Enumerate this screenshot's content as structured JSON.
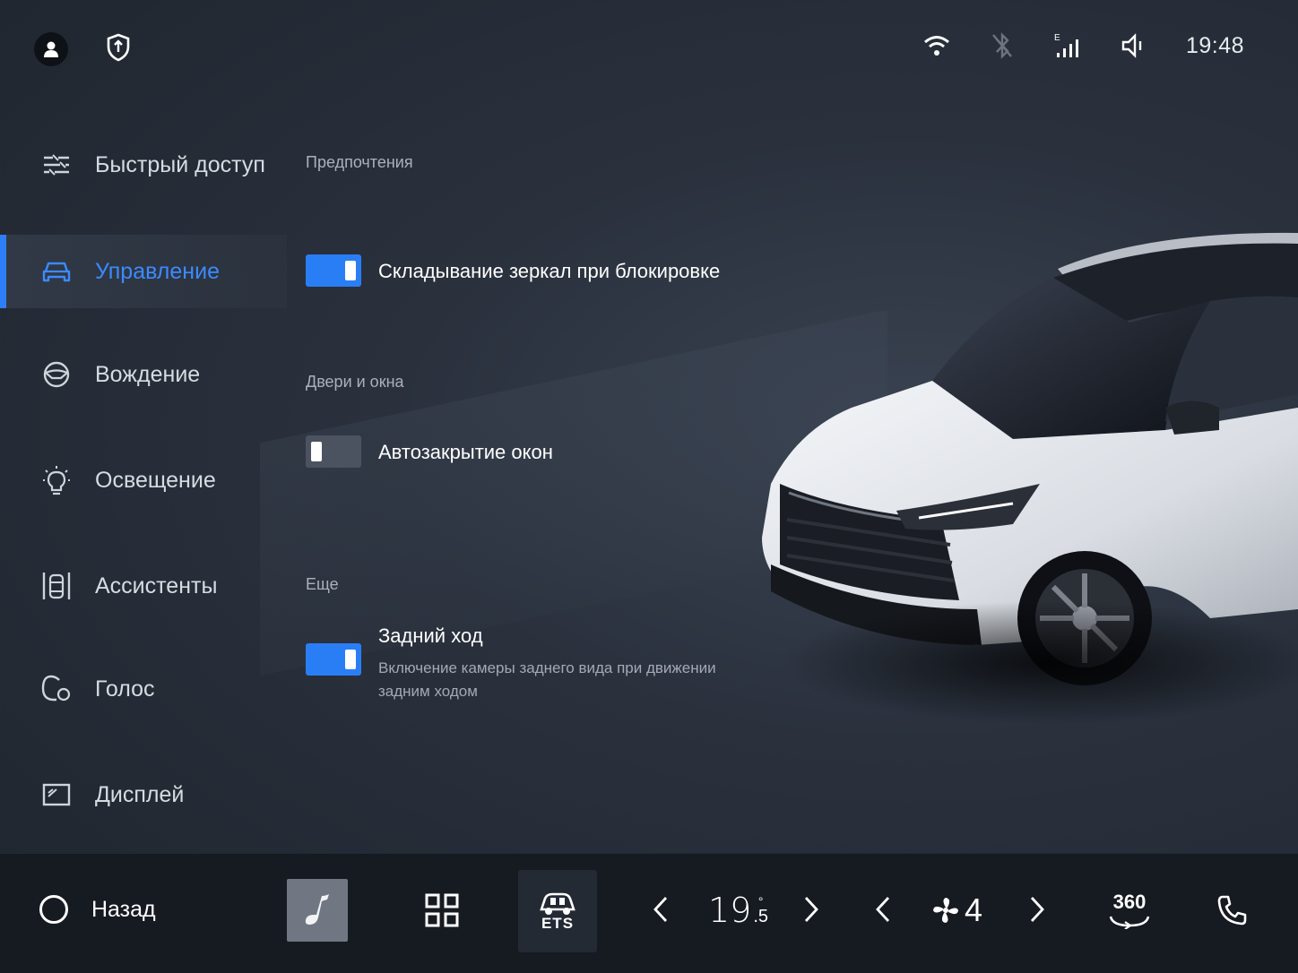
{
  "status": {
    "time": "19:48",
    "icons_left": [
      "user-icon",
      "shield-icon"
    ],
    "icons_right": [
      "wifi-icon",
      "bluetooth-off-icon",
      "cellular-signal-icon",
      "volume-icon"
    ],
    "signal_mode": "E"
  },
  "sidebar": {
    "items": [
      {
        "label": "Быстрый доступ",
        "icon": "quick-access-icon"
      },
      {
        "label": "Управление",
        "icon": "car-control-icon",
        "active": true
      },
      {
        "label": "Вождение",
        "icon": "steering-wheel-icon"
      },
      {
        "label": "Освещение",
        "icon": "bulb-icon"
      },
      {
        "label": "Ассистенты",
        "icon": "assistant-car-icon"
      },
      {
        "label": "Голос",
        "icon": "voice-icon"
      },
      {
        "label": "Дисплей",
        "icon": "display-icon"
      }
    ]
  },
  "content": {
    "sections": [
      {
        "title": "Предпочтения",
        "settings": [
          {
            "label": "Складывание зеркал при блокировке",
            "enabled": true
          }
        ]
      },
      {
        "title": "Двери и окна",
        "settings": [
          {
            "label": "Автозакрытие окон",
            "enabled": false
          }
        ]
      },
      {
        "title": "Еще",
        "settings": [
          {
            "label": "Задний ход",
            "description": "Включение камеры заднего вида при движении задним ходом",
            "enabled": true
          }
        ]
      }
    ]
  },
  "dock": {
    "back_label": "Назад",
    "ets_label": "ETS",
    "temperature_whole": "19",
    "temperature_degree": "°",
    "temperature_fraction": ".5",
    "fan_level": "4",
    "camera_label": "360"
  },
  "colors": {
    "accent": "#2a7ef5",
    "active_text": "#3b8bff",
    "background": "#2a313d",
    "dock": "#161a21"
  }
}
